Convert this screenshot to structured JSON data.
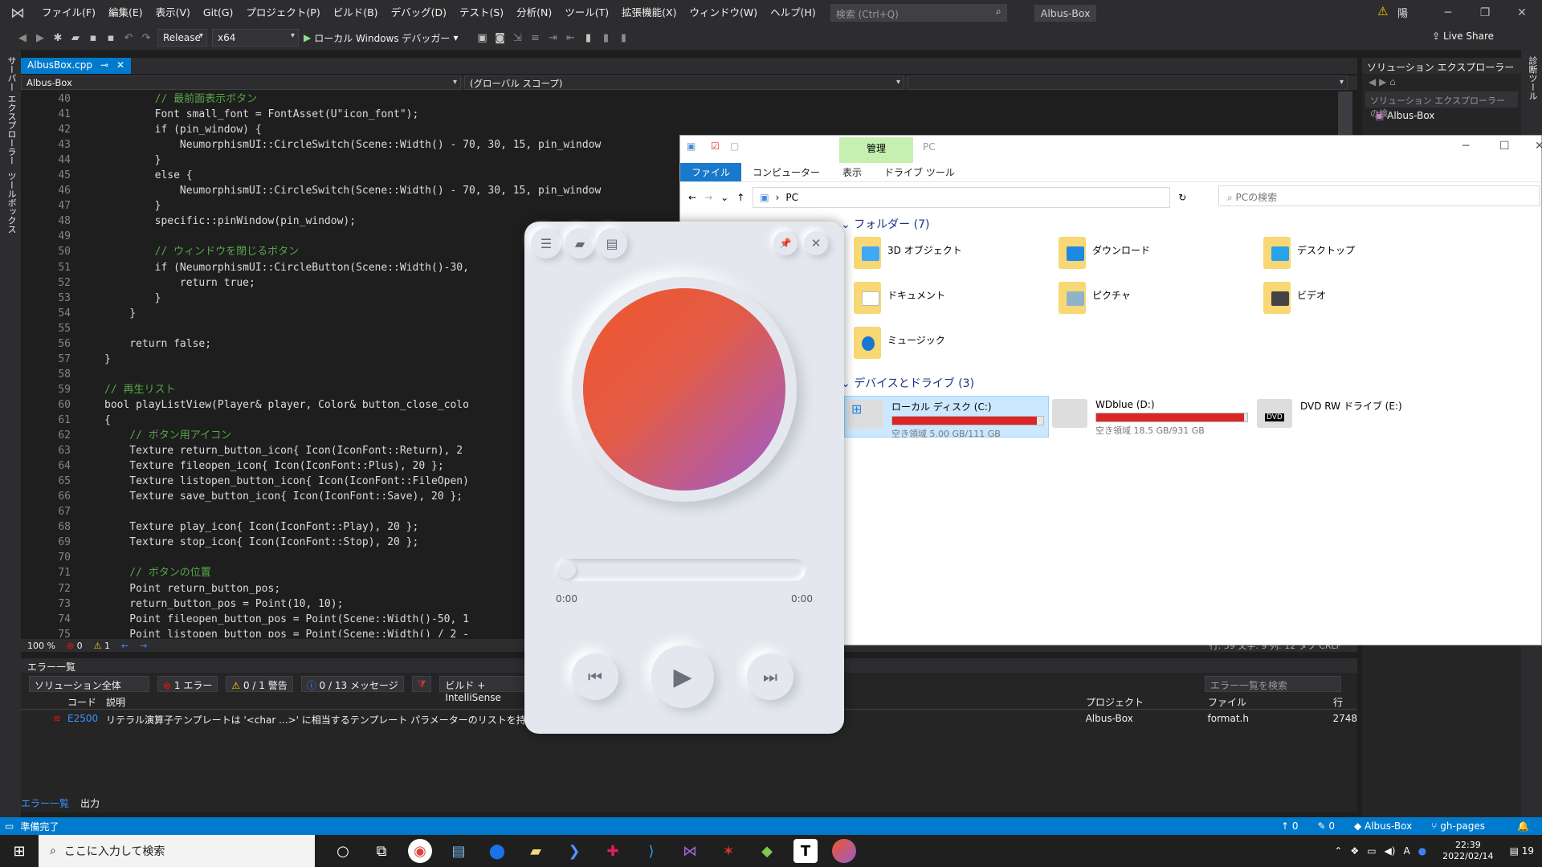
{
  "vs": {
    "menu": [
      "ファイル(F)",
      "編集(E)",
      "表示(V)",
      "Git(G)",
      "プロジェクト(P)",
      "ビルド(B)",
      "デバッグ(D)",
      "テスト(S)",
      "分析(N)",
      "ツール(T)",
      "拡張機能(X)",
      "ウィンドウ(W)",
      "ヘルプ(H)"
    ],
    "search_placeholder": "検索 (Ctrl+Q)",
    "solution_name": "Albus-Box",
    "user_badge": "陽",
    "config": "Release",
    "platform": "x64",
    "run_label": "ローカル Windows デバッガー",
    "live_share": "Live Share",
    "left_rail": [
      "サーバー エクスプローラー",
      "ツールボックス"
    ],
    "right_rail": [
      "診断ツール"
    ],
    "doc_tab": "AlbusBox.cpp",
    "nav_project": "Albus-Box",
    "nav_scope": "(グローバル スコープ)",
    "line_numbers": [
      "40",
      "41",
      "42",
      "43",
      "44",
      "45",
      "46",
      "47",
      "48",
      "49",
      "50",
      "51",
      "52",
      "53",
      "54",
      "55",
      "56",
      "57",
      "58",
      "59",
      "60",
      "61",
      "62",
      "63",
      "64",
      "65",
      "66",
      "67",
      "68",
      "69",
      "70",
      "71",
      "72",
      "73",
      "74",
      "75"
    ],
    "code_lines": [
      "        // 最前面表示ボタン",
      "        Font small_font = FontAsset(U\"icon_font\");",
      "        if (pin_window) {",
      "            NeumorphismUI::CircleSwitch(Scene::Width() - 70, 30, 15, pin_window",
      "        }",
      "        else {",
      "            NeumorphismUI::CircleSwitch(Scene::Width() - 70, 30, 15, pin_window",
      "        }",
      "        specific::pinWindow(pin_window);",
      "",
      "        // ウィンドウを閉じるボタン",
      "        if (NeumorphismUI::CircleButton(Scene::Width()-30,",
      "            return true;",
      "        }",
      "    }",
      "",
      "    return false;",
      "}",
      "",
      "// 再生リスト",
      "bool playListView(Player& player, Color& button_close_colo",
      "{",
      "    // ボタン用アイコン",
      "    Texture return_button_icon{ Icon(IconFont::Return), 2",
      "    Texture fileopen_icon{ Icon(IconFont::Plus), 20 };",
      "    Texture listopen_button_icon{ Icon(IconFont::FileOpen)",
      "    Texture save_button_icon{ Icon(IconFont::Save), 20 };",
      "",
      "    Texture play_icon{ Icon(IconFont::Play), 20 };",
      "    Texture stop_icon{ Icon(IconFont::Stop), 20 };",
      "",
      "    // ボタンの位置",
      "    Point return_button_pos;",
      "    return_button_pos = Point(10, 10);",
      "    Point fileopen_button_pos = Point(Scene::Width()-50, 1",
      "    Point listopen_button_pos = Point(Scene::Width() / 2 -"
    ],
    "zoom": "100 %",
    "err_count": "0",
    "warn_count": "1",
    "status_right": "行: 59    文字: 9    列: 12    タブ    CRLF",
    "error_list": {
      "title": "エラー一覧",
      "scope": "ソリューション全体",
      "errors_chip": "1 エラー",
      "warnings_chip": "0 / 1 警告",
      "messages_chip": "0 / 13 メッセージ",
      "build_filter": "ビルド + IntelliSense",
      "search_placeholder": "エラー一覧を検索",
      "columns": [
        "コード",
        "説明",
        "プロジェクト",
        "ファイル",
        "行"
      ],
      "rows": [
        {
          "code": "E2500",
          "desc": "リテラル演算子テンプレートは '<char ...>' に相当するテンプレート パラメーターのリストを持っている必要があります",
          "project": "Albus-Box",
          "file": "format.h",
          "line": "2748"
        }
      ],
      "tabs": [
        "エラー一覧",
        "出力"
      ]
    },
    "solution_explorer": {
      "title": "ソリューション エクスプローラー",
      "search_placeholder": "ソリューション エクスプローラー の検",
      "root": "Albus-Box"
    },
    "statusbar": {
      "ready": "準備完了",
      "up": "0",
      "pencil": "0",
      "repo": "Albus-Box",
      "branch": "gh-pages"
    }
  },
  "explorer": {
    "manage_tab": "管理",
    "title": "PC",
    "tabs": [
      "ファイル",
      "コンピューター",
      "表示",
      "ドライブ ツール"
    ],
    "address": "PC",
    "search_placeholder": "PCの検索",
    "folders_header": "フォルダー (7)",
    "folders": [
      "3D オブジェクト",
      "ダウンロード",
      "デスクトップ",
      "ドキュメント",
      "ピクチャ",
      "ビデオ",
      "ミュージック"
    ],
    "drives_header": "デバイスとドライブ (3)",
    "drives": [
      {
        "name": "ローカル ディスク (C:)",
        "free": "空き領域 5.00 GB/111 GB",
        "used_fraction": 0.955
      },
      {
        "name": "WDblue (D:)",
        "free": "空き領域 18.5 GB/931 GB",
        "used_fraction": 0.98
      },
      {
        "name": "DVD RW ドライブ (E:)",
        "free": "",
        "used_fraction": null
      }
    ]
  },
  "player": {
    "time_current": "0:00",
    "time_total": "0:00",
    "progress_fraction": 0.0
  },
  "taskbar": {
    "search_placeholder": "ここに入力して検索",
    "time": "22:39",
    "date": "2022/02/14",
    "notif_count": "19",
    "ime": "A"
  },
  "colors": {
    "vs_accent": "#007acc",
    "disc_gradient": [
      "#f0562b",
      "#9a5cc9"
    ],
    "drive_bar": "#da2626"
  }
}
